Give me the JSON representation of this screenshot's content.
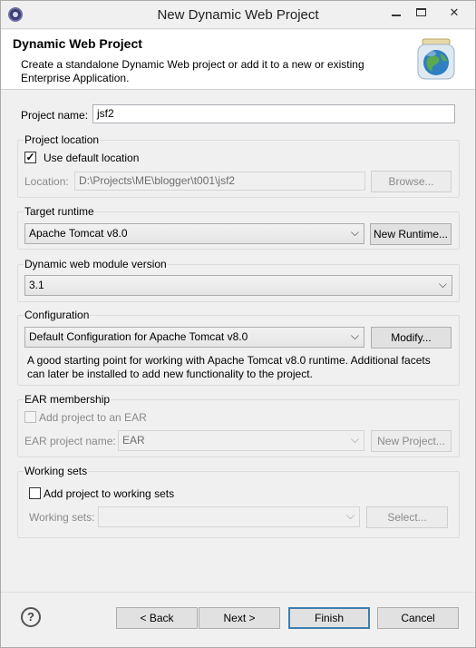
{
  "window": {
    "title": "New Dynamic Web Project"
  },
  "banner": {
    "title": "Dynamic Web Project",
    "description": "Create a standalone Dynamic Web project or add it to a new or existing Enterprise Application."
  },
  "project_name": {
    "label": "Project name:",
    "value": "jsf2"
  },
  "project_location": {
    "group_label": "Project location",
    "use_default_label": "Use default location",
    "use_default_checked": true,
    "location_label": "Location:",
    "location_value": "D:\\Projects\\ME\\blogger\\t001\\jsf2",
    "browse_label": "Browse..."
  },
  "target_runtime": {
    "group_label": "Target runtime",
    "selected": "Apache Tomcat v8.0",
    "new_runtime_label": "New Runtime..."
  },
  "module_version": {
    "group_label": "Dynamic web module version",
    "selected": "3.1"
  },
  "configuration": {
    "group_label": "Configuration",
    "selected": "Default Configuration for Apache Tomcat v8.0",
    "modify_label": "Modify...",
    "description": "A good starting point for working with Apache Tomcat v8.0 runtime. Additional facets can later be installed to add new functionality to the project."
  },
  "ear_membership": {
    "group_label": "EAR membership",
    "add_label": "Add project to an EAR",
    "name_label": "EAR project name:",
    "name_value": "EAR",
    "new_project_label": "New Project..."
  },
  "working_sets": {
    "group_label": "Working sets",
    "add_label": "Add project to working sets",
    "sets_label": "Working sets:",
    "sets_value": "",
    "select_label": "Select..."
  },
  "footer": {
    "help_glyph": "?",
    "back_label": "< Back",
    "next_label": "Next >",
    "finish_label": "Finish",
    "cancel_label": "Cancel"
  },
  "icons": {
    "app": "eclipse-icon",
    "banner": "web-project-globe-icon",
    "check_mark": "✓",
    "chevron": "⌵",
    "close": "✕"
  }
}
